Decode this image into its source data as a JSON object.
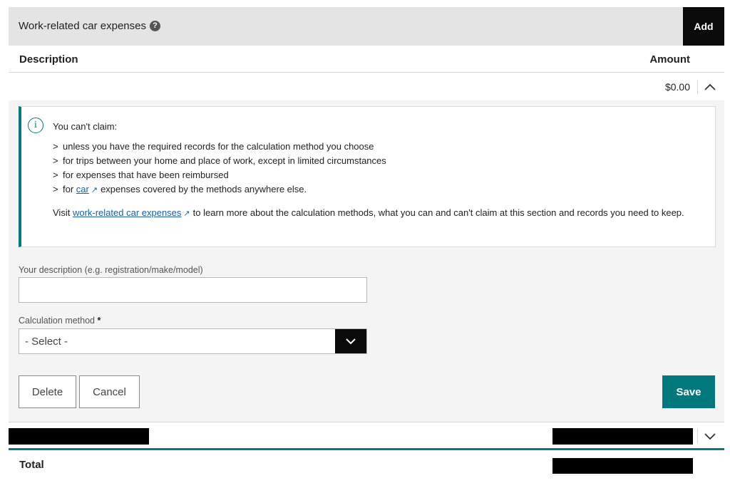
{
  "header": {
    "title": "Work-related car expenses",
    "help_icon": "?",
    "add_label": "Add"
  },
  "columns": {
    "description": "Description",
    "amount": "Amount"
  },
  "expanded_item": {
    "amount": "$0.00",
    "info": {
      "icon": "i",
      "title": "You can't claim:",
      "bullets": [
        "unless you have the required records for the calculation method you choose",
        "for trips between your home and place of work, except in limited circumstances",
        "for expenses that have been reimbursed"
      ],
      "last_bullet_prefix": "for",
      "last_bullet_link": "car",
      "last_bullet_suffix": "expenses covered by the methods anywhere else.",
      "para_prefix": "Visit",
      "para_link": "work-related car expenses",
      "para_suffix": "to learn more about the calculation methods, what you can and can't claim at this section and records you need to keep."
    },
    "form": {
      "description_label": "Your description (e.g. registration/make/model)",
      "description_value": "",
      "method_label": "Calculation method",
      "required_marker": "*",
      "method_value": "- Select -"
    },
    "buttons": {
      "delete": "Delete",
      "cancel": "Cancel",
      "save": "Save"
    }
  },
  "footer": {
    "total_label": "Total"
  },
  "colors": {
    "teal": "#007b80",
    "header_bg": "#e4e4e4",
    "link": "#1a5fb4"
  }
}
